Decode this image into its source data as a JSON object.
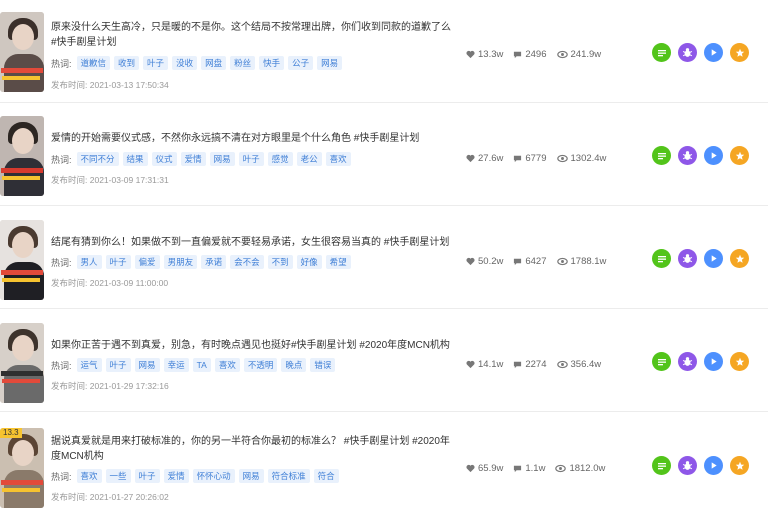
{
  "colors": {
    "tag_text": "#3f7fd6",
    "tag_bg": "#e9f1fc",
    "btn_green": "#52c41a",
    "btn_purple": "#8e57e8",
    "btn_blue": "#4d90fe",
    "btn_orange": "#f5a623"
  },
  "labels": {
    "hot_words": "热词:",
    "publish_time": "发布时间:"
  },
  "icons": [
    "heart-icon",
    "comment-icon",
    "eye-icon",
    "list-icon",
    "bug-icon",
    "play-icon",
    "star-icon"
  ],
  "videos": [
    {
      "title": "原来没什么天生高冷，只是暖的不是你。这个结局不按常理出牌，你们收到同款的道歉了么 #快手剧星计划",
      "tags": [
        "道歉信",
        "收到",
        "叶子",
        "没收",
        "网盘",
        "粉丝",
        "快手",
        "公子",
        "网易"
      ],
      "date": "2021-03-13 17:50:34",
      "likes": "13.3w",
      "comments": "2496",
      "views": "241.9w"
    },
    {
      "title": "爱情的开始需要仪式感，不然你永远搞不清在对方眼里是个什么角色 #快手剧星计划",
      "tags": [
        "不同不分",
        "结果",
        "仪式",
        "爱情",
        "网易",
        "叶子",
        "感觉",
        "老公",
        "喜欢"
      ],
      "date": "2021-03-09 17:31:31",
      "likes": "27.6w",
      "comments": "6779",
      "views": "1302.4w"
    },
    {
      "title": "结尾有猜到你么！如果做不到一直偏爱就不要轻易承诺，女生很容易当真的 #快手剧星计划",
      "tags": [
        "男人",
        "叶子",
        "偏爱",
        "男朋友",
        "承诺",
        "会不会",
        "不到",
        "好像",
        "希望"
      ],
      "date": "2021-03-09 11:00:00",
      "likes": "50.2w",
      "comments": "6427",
      "views": "1788.1w"
    },
    {
      "title": "如果你正苦于遇不到真爱，别急，有时晚点遇见也挺好#快手剧星计划 #2020年度MCN机构",
      "tags": [
        "运气",
        "叶子",
        "网易",
        "幸运",
        "TA",
        "喜欢",
        "不透明",
        "晚点",
        "错误"
      ],
      "date": "2021-01-29 17:32:16",
      "likes": "14.1w",
      "comments": "2274",
      "views": "356.4w"
    },
    {
      "title": "据说真爱就是用来打破标准的，你的另一半符合你最初的标准么？ #快手剧星计划 #2020年度MCN机构",
      "tags": [
        "喜欢",
        "一些",
        "叶子",
        "爱情",
        "怀怀心动",
        "网易",
        "符合标准",
        "符合"
      ],
      "date": "2021-01-27 20:26:02",
      "likes": "65.9w",
      "comments": "1.1w",
      "views": "1812.0w"
    }
  ]
}
